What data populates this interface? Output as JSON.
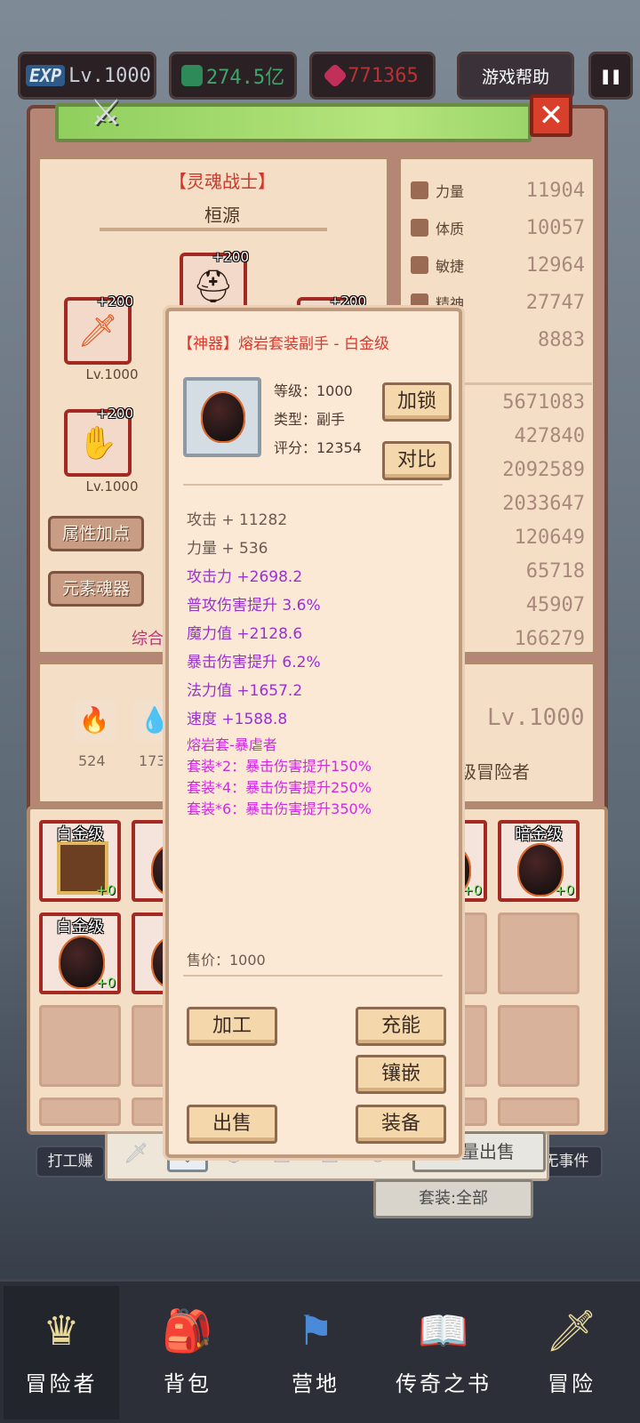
{
  "hud": {
    "exp_badge": "EXP",
    "level": "Lv.1000",
    "gold": "274.5亿",
    "gems": "771365",
    "help_label": "游戏帮助",
    "pause_icon": "pause-icon"
  },
  "character": {
    "class": "【灵魂战士】",
    "name": "桓源",
    "slots": [
      {
        "plus": "+200",
        "level": "Lv.1000",
        "icon": "flame-sword-icon"
      },
      {
        "plus": "+200",
        "level": "Lv.1000",
        "icon": "gauntlet-icon"
      },
      {
        "plus": "+200",
        "icon": "helmet-icon"
      },
      {
        "plus": "+200",
        "icon": "armor-icon"
      }
    ],
    "buttons": {
      "attr_points": "属性加点",
      "element_soul": "元素魂器"
    },
    "score_partial": "综合",
    "stats": [
      {
        "label": "力量",
        "value": "11904"
      },
      {
        "label": "体质",
        "value": "10057"
      },
      {
        "label": "敏捷",
        "value": "12964"
      },
      {
        "label": "精神",
        "value": "27747"
      },
      {
        "label": "力",
        "value": "8883"
      }
    ],
    "stats2": [
      "5671083",
      "427840",
      "2092589",
      "2033647",
      "120649",
      "65718",
      "45907",
      "166279"
    ],
    "resources": [
      {
        "value": "524",
        "icon": "fire-orb-icon"
      },
      {
        "value": "173",
        "icon": "water-orb-icon"
      }
    ],
    "right_level": "Lv.1000",
    "rank": "级冒险者"
  },
  "tooltip": {
    "title": "【神器】熔岩套装副手 - 白金级",
    "level_line": "等级：1000",
    "type_line": "类型：副手",
    "score_line": "评分：12354",
    "lock_label": "加锁",
    "compare_label": "对比",
    "base_attrs": [
      "攻击 + 11282",
      "力量 + 536"
    ],
    "bonus_attrs": [
      "攻击力 +2698.2",
      "普攻伤害提升 3.6%",
      "魔力值 +2128.6",
      "暴击伤害提升 6.2%",
      "法力值 +1657.2",
      "速度 +1588.8"
    ],
    "set_name": "熔岩套-暴虐者",
    "set_bonuses": [
      "套装*2：暴击伤害提升150%",
      "套装*4：暴击伤害提升250%",
      "套装*6：暴击伤害提升350%"
    ],
    "sell_price": "售价：1000",
    "actions": {
      "process": "加工",
      "charge": "充能",
      "inlay": "镶嵌",
      "sell": "出售",
      "equip": "装备"
    }
  },
  "inventory": {
    "items": [
      {
        "rarity": "白金级",
        "plus": "+0",
        "kind": "chest"
      },
      {
        "rarity": "白",
        "plus": "+0",
        "kind": "egg"
      },
      {
        "rarity": "级",
        "plus": "+0",
        "kind": "egg"
      },
      {
        "rarity": "暗金级",
        "plus": "+0",
        "kind": "egg"
      },
      {
        "rarity": "白金级",
        "plus": "+0",
        "kind": "egg"
      },
      {
        "rarity": "黑",
        "plus": "+0",
        "kind": "egg"
      }
    ],
    "batch_sell": "批量出售",
    "set_filter": "套装:全部",
    "bg_left": "打工赚",
    "bg_right": "无事件"
  },
  "tabs": [
    "sword-icon",
    "offhand-icon",
    "helmet-icon",
    "armor-icon",
    "pants-icon",
    "ring-icon"
  ],
  "nav": [
    {
      "label": "冒险者",
      "icon": "crown-helmet-icon"
    },
    {
      "label": "背包",
      "icon": "backpack-icon"
    },
    {
      "label": "营地",
      "icon": "camp-banner-icon"
    },
    {
      "label": "传奇之书",
      "icon": "book-icon"
    },
    {
      "label": "冒险",
      "icon": "sword-icon"
    }
  ]
}
